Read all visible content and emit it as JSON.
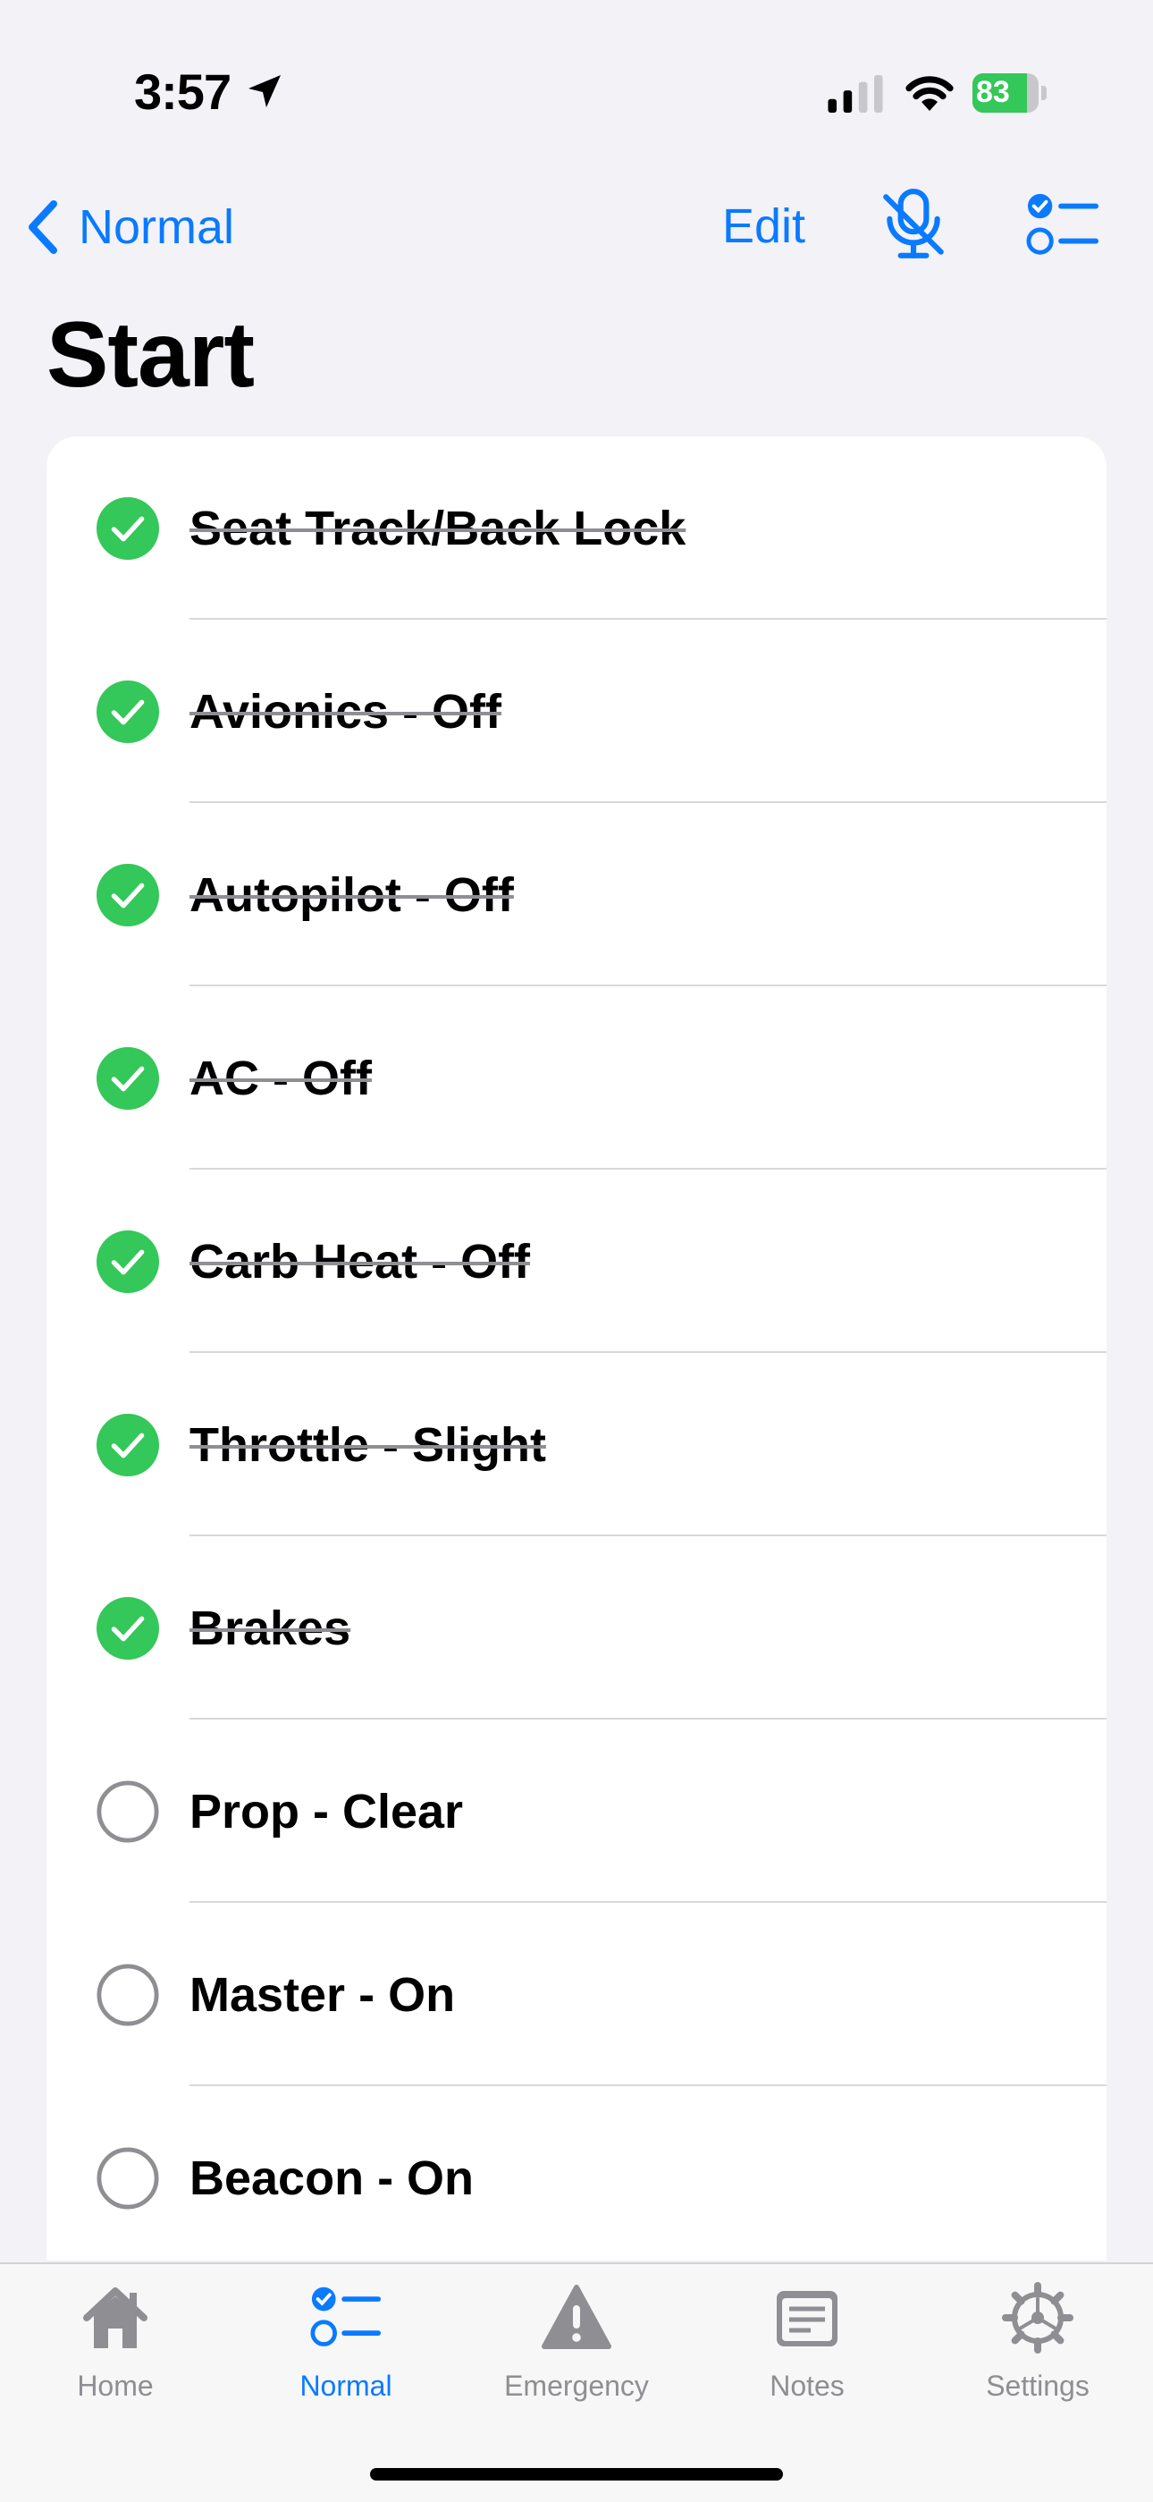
{
  "status_bar": {
    "time": "3:57",
    "battery_percent": "83",
    "battery_level": 0.83,
    "battery_color": "#34c759"
  },
  "nav": {
    "back_label": "Normal",
    "edit_label": "Edit",
    "mic_icon": "mic-slash-icon",
    "list_icon": "checklist-icon"
  },
  "page": {
    "title": "Start"
  },
  "checklist": {
    "items": [
      {
        "label": "Seat Track/Back Lock",
        "checked": true
      },
      {
        "label": "Avionics - Off",
        "checked": true
      },
      {
        "label": "Autopilot - Off",
        "checked": true
      },
      {
        "label": "AC - Off",
        "checked": true
      },
      {
        "label": "Carb Heat - Off",
        "checked": true
      },
      {
        "label": "Throttle - Slight",
        "checked": true
      },
      {
        "label": "Brakes",
        "checked": true
      },
      {
        "label": "Prop - Clear",
        "checked": false
      },
      {
        "label": "Master - On",
        "checked": false
      },
      {
        "label": "Beacon - On",
        "checked": false
      }
    ]
  },
  "tabs": [
    {
      "label": "Home",
      "icon": "house-icon",
      "active": false
    },
    {
      "label": "Normal",
      "icon": "checklist-icon",
      "active": true
    },
    {
      "label": "Emergency",
      "icon": "warning-triangle-icon",
      "active": false
    },
    {
      "label": "Notes",
      "icon": "notes-icon",
      "active": false
    },
    {
      "label": "Settings",
      "icon": "gear-icon",
      "active": false
    }
  ],
  "colors": {
    "accent": "#0a7aff",
    "check_green": "#34c759",
    "inactive_gray": "#8e8e93"
  }
}
